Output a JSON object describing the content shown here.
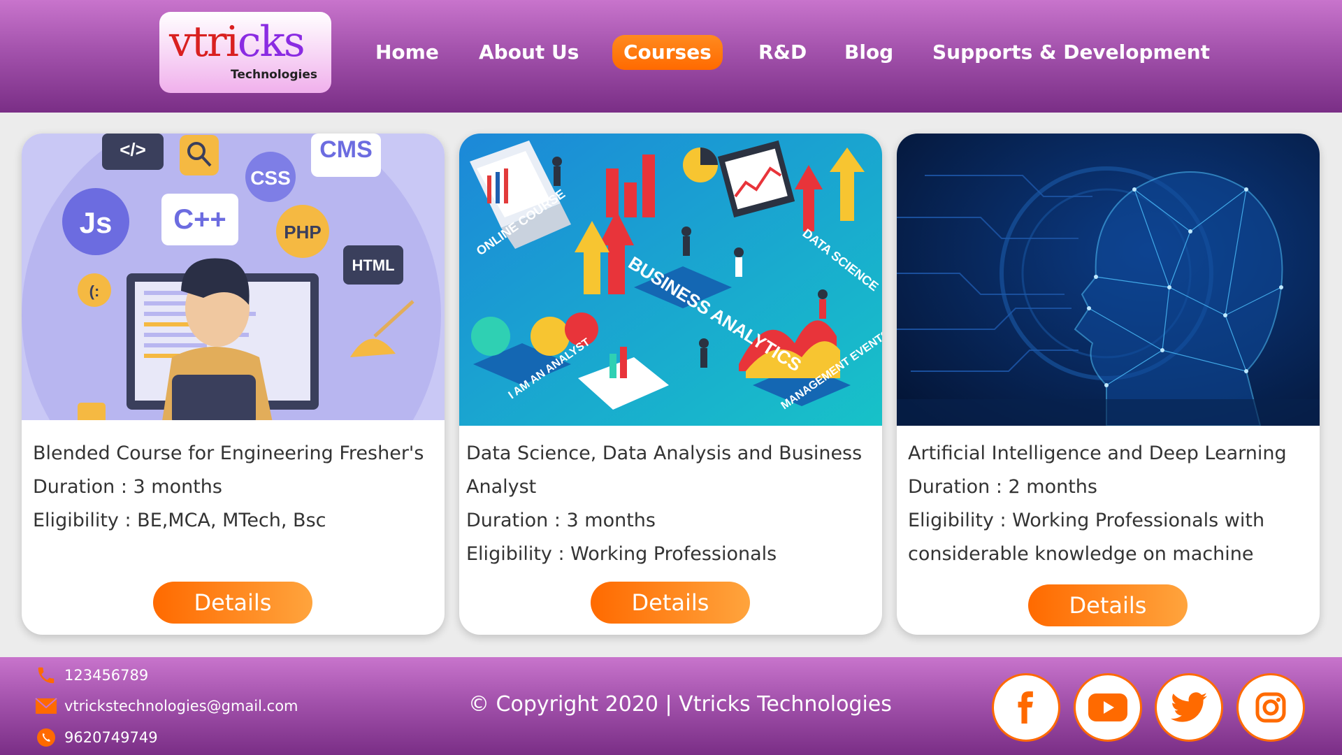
{
  "brand": {
    "logo_main_a": "vtri",
    "logo_main_b": "cks",
    "logo_sub": "Technologies"
  },
  "nav": {
    "items": [
      {
        "label": "Home"
      },
      {
        "label": "About Us"
      },
      {
        "label": "Courses",
        "active": true
      },
      {
        "label": "R&D"
      },
      {
        "label": "Blog"
      },
      {
        "label": "Supports & Development"
      }
    ]
  },
  "courses": [
    {
      "title": "Blended Course for Engineering Fresher's",
      "duration": "Duration : 3 months",
      "eligibility": "Eligibility : BE,MCA, MTech, Bsc",
      "button": "Details",
      "image_icon": "programming-illustration"
    },
    {
      "title": "Data Science, Data Analysis and Business Analyst",
      "duration": "Duration : 3 months",
      "eligibility": "Eligibility : Working Professionals",
      "button": "Details",
      "image_icon": "business-analytics-illustration",
      "image_texts": [
        "ONLINE COURSE",
        "BUSINESS ANALYTICS",
        "DATA SCIENCE",
        "I AM AN ANALYST",
        "MANAGEMENT EVENTS"
      ]
    },
    {
      "title": "Artificial Intelligence and Deep Learning",
      "duration": "Duration : 2 months",
      "eligibility": "Eligibility : Working Professionals with considerable knowledge on machine",
      "button": "Details",
      "image_icon": "ai-head-illustration"
    }
  ],
  "illustration_labels": {
    "code": "</>",
    "cms": "CMS",
    "css": "CSS",
    "js": "Js",
    "cpp": "C++",
    "php": "PHP",
    "html": "HTML",
    "smile": "(:"
  },
  "footer": {
    "phone": "123456789",
    "email": "vtrickstechnologies@gmail.com",
    "whatsapp": "9620749749",
    "copyright": "© Copyright 2020 | Vtricks Technologies",
    "social": [
      "facebook-icon",
      "youtube-icon",
      "twitter-icon",
      "instagram-icon"
    ]
  },
  "colors": {
    "header_top": "#c874cc",
    "header_bottom": "#7a2e86",
    "accent_orange": "#ff6a00",
    "accent_orange_light": "#ffa43d"
  }
}
